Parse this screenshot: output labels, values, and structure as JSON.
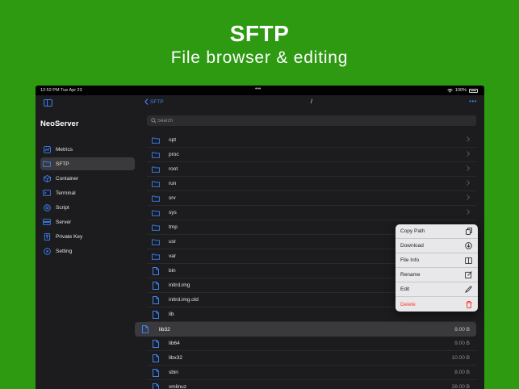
{
  "hero": {
    "title": "SFTP",
    "subtitle": "File browser & editing"
  },
  "status_bar": {
    "time": "12:52 PM   Tue Apr 23",
    "dots": "•••",
    "battery": "100%"
  },
  "sidebar": {
    "app_name": "NeoServer",
    "items": [
      {
        "label": "Metrics",
        "icon": "metrics-icon"
      },
      {
        "label": "SFTP",
        "icon": "folder-icon",
        "active": true
      },
      {
        "label": "Container",
        "icon": "cube-icon"
      },
      {
        "label": "Terminal",
        "icon": "terminal-icon"
      },
      {
        "label": "Script",
        "icon": "gear-icon"
      },
      {
        "label": "Server",
        "icon": "server-icon"
      },
      {
        "label": "Private Key",
        "icon": "key-icon"
      },
      {
        "label": "Setting",
        "icon": "play-icon"
      }
    ]
  },
  "nav": {
    "back_label": "SFTP",
    "title": "/",
    "more": "•••"
  },
  "search": {
    "placeholder": "Search"
  },
  "files": [
    {
      "name": "opt",
      "type": "folder"
    },
    {
      "name": "proc",
      "type": "folder"
    },
    {
      "name": "root",
      "type": "folder"
    },
    {
      "name": "run",
      "type": "folder"
    },
    {
      "name": "srv",
      "type": "folder"
    },
    {
      "name": "sys",
      "type": "folder"
    },
    {
      "name": "tmp",
      "type": "folder"
    },
    {
      "name": "usr",
      "type": "folder"
    },
    {
      "name": "var",
      "type": "folder"
    },
    {
      "name": "bin",
      "type": "file",
      "size": ""
    },
    {
      "name": "initrd.img",
      "type": "file",
      "size": ""
    },
    {
      "name": "initrd.img.old",
      "type": "file",
      "size": ""
    },
    {
      "name": "lib",
      "type": "file",
      "size": ""
    },
    {
      "name": "lib32",
      "type": "file",
      "size": "9.00 B",
      "selected": true
    },
    {
      "name": "lib64",
      "type": "file",
      "size": "9.00 B"
    },
    {
      "name": "libx32",
      "type": "file",
      "size": "10.00 B"
    },
    {
      "name": "sbin",
      "type": "file",
      "size": "8.00 B"
    },
    {
      "name": "vmlinuz",
      "type": "file",
      "size": "28.00 B"
    }
  ],
  "context_menu": [
    {
      "label": "Copy Path",
      "icon": "copy-icon"
    },
    {
      "label": "Download",
      "icon": "download-icon"
    },
    {
      "label": "File Info",
      "icon": "info-icon"
    },
    {
      "label": "Rename",
      "icon": "rename-icon"
    },
    {
      "label": "Edit",
      "icon": "pencil-icon"
    },
    {
      "label": "Delete",
      "icon": "trash-icon",
      "danger": true
    }
  ],
  "colors": {
    "background": "#2e9a12",
    "accent": "#3b82f6",
    "danger": "#ff3b30"
  }
}
